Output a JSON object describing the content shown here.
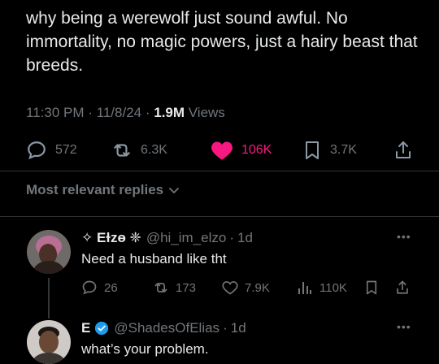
{
  "tweet": {
    "text": "why being a werewolf just sound awful. No immortality, no magic powers, just a hairy beast that breeds.",
    "time": "11:30 PM",
    "date": "11/8/24",
    "views_count": "1.9M",
    "views_label": "Views",
    "replies": "572",
    "reposts": "6.3K",
    "likes": "106K",
    "bookmarks": "3.7K",
    "like_color": "#f91880"
  },
  "section": {
    "label": "Most relevant replies"
  },
  "replies": [
    {
      "name": "✧ Eɫzɵ ❈",
      "handle": "@hi_im_elzo",
      "age": "1d",
      "text": "Need a husband like tht",
      "replies": "26",
      "reposts": "173",
      "likes": "7.9K",
      "views": "110K"
    },
    {
      "name": "E",
      "handle": "@ShadesOfElias",
      "age": "1d",
      "text": "what’s your problem.",
      "verified_color": "#1d9bf0"
    }
  ],
  "icons": [
    "reply-icon",
    "repost-icon",
    "heart-icon",
    "bookmark-icon",
    "share-icon",
    "chevron-down-icon",
    "more-icon",
    "views-icon",
    "verified-badge-icon"
  ]
}
